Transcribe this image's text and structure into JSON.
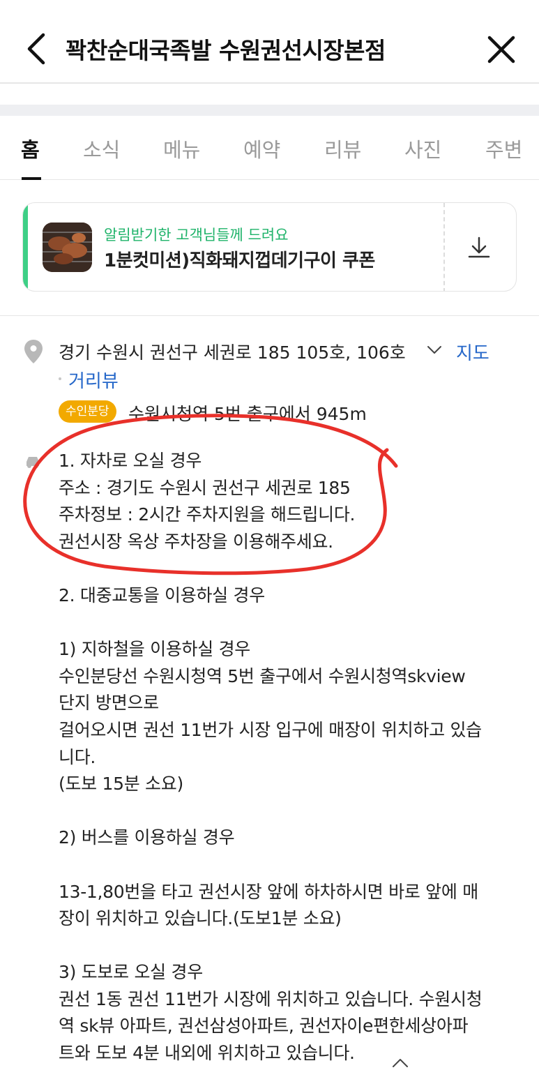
{
  "header": {
    "title": "꽉찬순대국족발 수원권선시장본점"
  },
  "tabs": [
    {
      "label": "홈"
    },
    {
      "label": "소식"
    },
    {
      "label": "메뉴"
    },
    {
      "label": "예약"
    },
    {
      "label": "리뷰"
    },
    {
      "label": "사진"
    },
    {
      "label": "주변"
    }
  ],
  "coupon": {
    "subtitle": "알림받기한 고객님들께 드려요",
    "title": "1분컷미션)직화돼지껍데기구이 쿠폰"
  },
  "location": {
    "address": "경기 수원시 권선구 세권로 185 105호, 106호",
    "map_label": "지도",
    "street_view_label": "거리뷰",
    "subway_line": "수인분당",
    "subway_text": "수원시청역 5번 출구에서 945m"
  },
  "directions": {
    "lines": [
      "1. 자차로 오실 경우",
      "주소 : 경기도 수원시 권선구 세권로 185",
      "주차정보 : 2시간 주차지원을 해드립니다.",
      "권선시장 옥상 주차장을 이용해주세요.",
      "",
      "2. 대중교통을 이용하실 경우",
      "",
      "1) 지하철을 이용하실 경우",
      "수인분당선 수원시청역 5번 출구에서 수원시청역skview",
      "단지 방면으로",
      "걸어오시면 권선 11번가 시장 입구에 매장이 위치하고 있습",
      "니다.",
      "(도보 15분 소요)",
      "",
      "2) 버스를 이용하실 경우",
      "",
      "13-1,80번을 타고 권선시장 앞에 하차하시면 바로 앞에 매",
      "장이 위치하고 있습니다.(도보1분 소요)",
      "",
      "3) 도보로 오실 경우",
      "권선 1동 권선 11번가 시장에 위치하고 있습니다. 수원시청",
      "역 sk뷰 아파트, 권선삼성아파트, 권선자이e편한세상아파",
      "트와 도보 4분 내외에 위치하고 있습니다."
    ]
  },
  "colors": {
    "accent_green": "#3ecf86",
    "link_blue": "#2567c9",
    "subway_badge": "#f2a900",
    "annotation_red": "#e8302a"
  },
  "icons": {
    "back": "chevron-left-icon",
    "close": "close-icon",
    "download": "download-icon",
    "pin": "map-pin-icon",
    "expand": "chevron-down-icon",
    "collapse": "chevron-up-icon",
    "car": "car-icon"
  }
}
